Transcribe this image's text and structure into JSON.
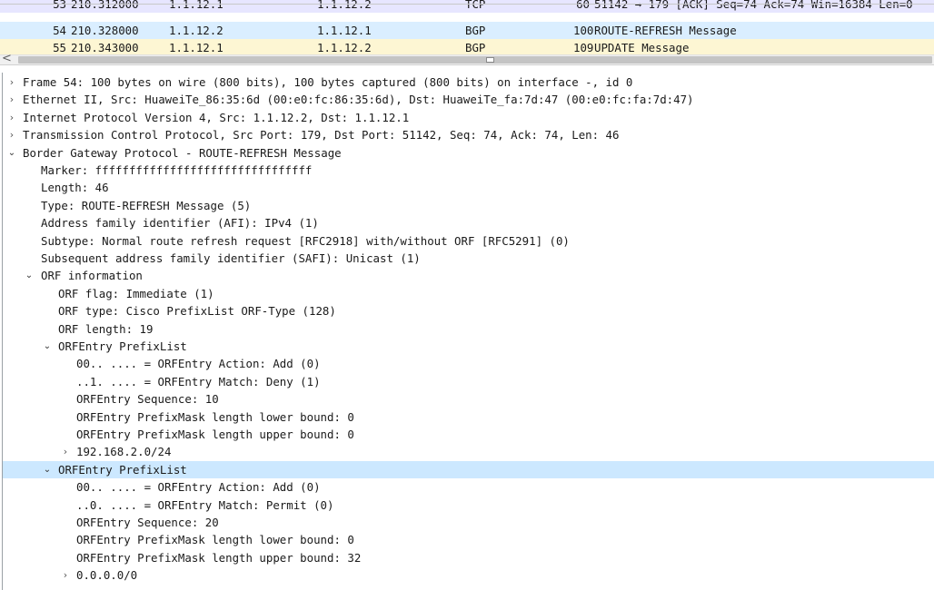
{
  "packet_list": {
    "rows": [
      {
        "no": "53",
        "time": "210.312000",
        "source": "1.1.12.1",
        "destination": "1.1.12.2",
        "protocol": "TCP",
        "length": "60",
        "info": "51142 → 179 [ACK] Seq=74 Ack=74 Win=16384 Len=0"
      },
      {
        "no": "54",
        "time": "210.328000",
        "source": "1.1.12.2",
        "destination": "1.1.12.1",
        "protocol": "BGP",
        "length": "100",
        "info": "ROUTE-REFRESH Message"
      },
      {
        "no": "55",
        "time": "210.343000",
        "source": "1.1.12.1",
        "destination": "1.1.12.2",
        "protocol": "BGP",
        "length": "109",
        "info": "UPDATE Message"
      }
    ]
  },
  "scrollbar": {
    "left_arrow": "<"
  },
  "details": {
    "frame": "Frame 54: 100 bytes on wire (800 bits), 100 bytes captured (800 bits) on interface -, id 0",
    "ethernet": "Ethernet II, Src: HuaweiTe_86:35:6d (00:e0:fc:86:35:6d), Dst: HuaweiTe_fa:7d:47 (00:e0:fc:fa:7d:47)",
    "ip": "Internet Protocol Version 4, Src: 1.1.12.2, Dst: 1.1.12.1",
    "tcp": "Transmission Control Protocol, Src Port: 179, Dst Port: 51142, Seq: 74, Ack: 74, Len: 46",
    "bgp": {
      "title": "Border Gateway Protocol - ROUTE-REFRESH Message",
      "marker": "Marker: ffffffffffffffffffffffffffffffff",
      "length": "Length: 46",
      "type": "Type: ROUTE-REFRESH Message (5)",
      "afi": "Address family identifier (AFI): IPv4 (1)",
      "subtype": "Subtype: Normal route refresh request [RFC2918] with/without ORF [RFC5291] (0)",
      "safi": "Subsequent address family identifier (SAFI): Unicast (1)",
      "orf": {
        "title": "ORF information",
        "flag": "ORF flag: Immediate (1)",
        "type": "ORF type: Cisco PrefixList ORF-Type (128)",
        "length": "ORF length: 19",
        "entries": [
          {
            "title": "ORFEntry PrefixList",
            "action": "00.. .... = ORFEntry Action: Add (0)",
            "match": "..1. .... = ORFEntry Match: Deny (1)",
            "sequence": "ORFEntry Sequence: 10",
            "lower": "ORFEntry PrefixMask length lower bound: 0",
            "upper": "ORFEntry PrefixMask length upper bound: 0",
            "prefix": "192.168.2.0/24"
          },
          {
            "title": "ORFEntry PrefixList",
            "action": "00.. .... = ORFEntry Action: Add (0)",
            "match": "..0. .... = ORFEntry Match: Permit (0)",
            "sequence": "ORFEntry Sequence: 20",
            "lower": "ORFEntry PrefixMask length lower bound: 0",
            "upper": "ORFEntry PrefixMask length upper bound: 32",
            "prefix": "0.0.0.0/0"
          }
        ]
      }
    }
  },
  "icons": {
    "collapsed": "chevron-right-icon",
    "expanded": "chevron-down-icon"
  },
  "colors": {
    "row_tcp_ack": "#e7e6ff",
    "row_selected": "#daeeff",
    "row_bgp_update": "#fdf6d3",
    "tree_highlight": "#cce8ff"
  }
}
